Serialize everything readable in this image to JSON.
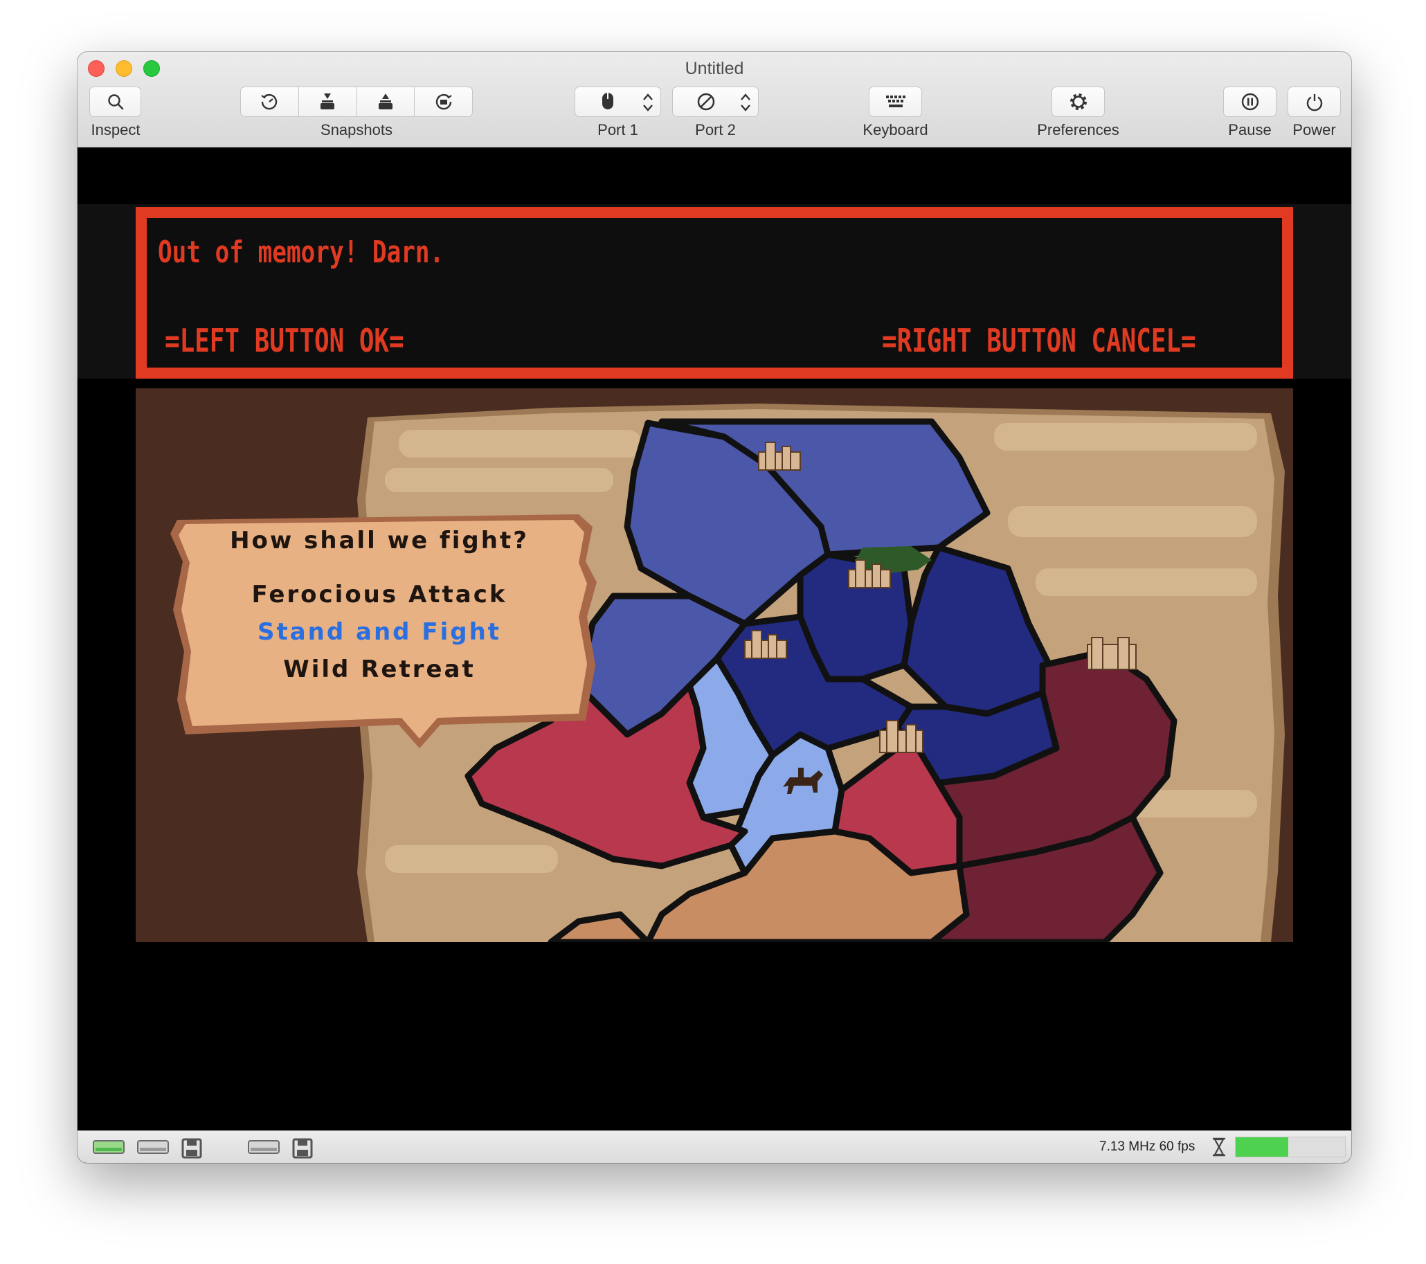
{
  "window": {
    "title": "Untitled"
  },
  "toolbar": {
    "inspect": "Inspect",
    "snapshots": "Snapshots",
    "port1": "Port 1",
    "port2": "Port 2",
    "keyboard": "Keyboard",
    "preferences": "Preferences",
    "pause": "Pause",
    "power": "Power"
  },
  "dialog": {
    "message": "Out of memory!  Darn.",
    "left": "=LEFT BUTTON OK=",
    "right": "=RIGHT BUTTON CANCEL="
  },
  "battle_menu": {
    "question": "How shall we fight?",
    "options": [
      "Ferocious Attack",
      "Stand and Fight",
      "Wild Retreat"
    ],
    "selected_index": 1
  },
  "status": {
    "speed_text": "7.13 MHz 60 fps",
    "speed_level": 0.48
  },
  "colors": {
    "dialog_red": "#e03a22",
    "selected_option": "#2a6fe0",
    "parchment": "#e8b184",
    "map_bg": "#4a2d20",
    "speed_green": "#4ed14e"
  }
}
